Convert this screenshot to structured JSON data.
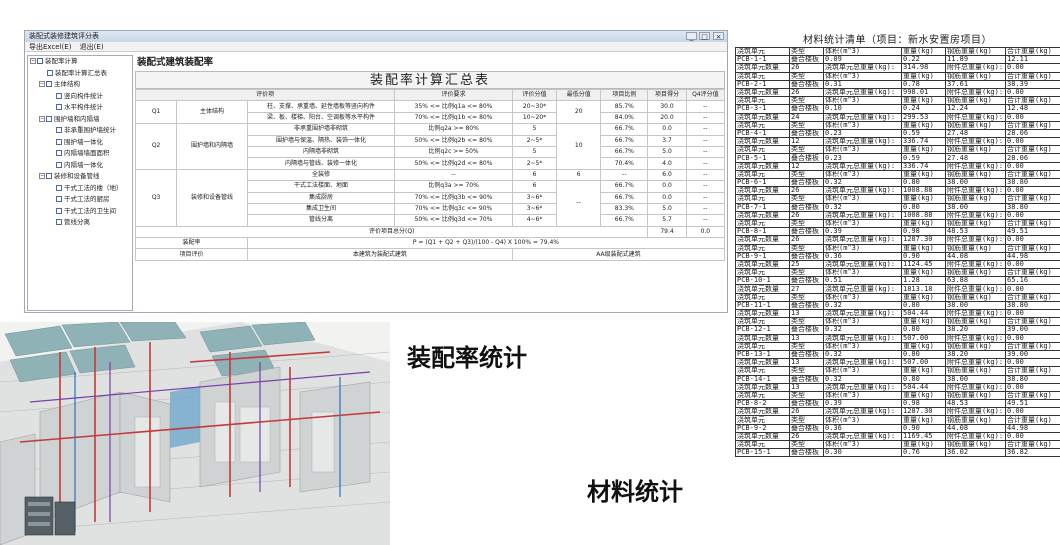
{
  "window": {
    "title": "装配式装修建筑评分表",
    "menu": [
      "导出Excel(E)",
      "退出(E)"
    ],
    "buttons": [
      "_",
      "□",
      "×"
    ]
  },
  "tree": [
    {
      "label": "装配率计算",
      "level": 0,
      "expander": "−"
    },
    {
      "label": "装配率计算汇总表",
      "level": 1
    },
    {
      "label": "主体结构",
      "level": 1,
      "expander": "−"
    },
    {
      "label": "竖向构件统计",
      "level": 2
    },
    {
      "label": "水平构件统计",
      "level": 2
    },
    {
      "label": "围护墙和内隔墙",
      "level": 1,
      "expander": "−"
    },
    {
      "label": "非承重围护墙统计",
      "level": 2
    },
    {
      "label": "围护墙一体化",
      "level": 2
    },
    {
      "label": "内隔墙墙面面积",
      "level": 2
    },
    {
      "label": "内隔墙一体化",
      "level": 2
    },
    {
      "label": "装修和设备管线",
      "level": 1,
      "expander": "−"
    },
    {
      "label": "干式工法的楼（地）",
      "level": 2
    },
    {
      "label": "干式工法的厨房",
      "level": 2
    },
    {
      "label": "干式工法的卫生间",
      "level": 2
    },
    {
      "label": "管线分离",
      "level": 2
    }
  ],
  "main": {
    "title": "装配式建筑装配率",
    "table_title": "装配率计算汇总表",
    "headers": [
      "评价项",
      "评价要求",
      "评价分值",
      "最低分值",
      "项目比例",
      "项目得分",
      "Q4评分值"
    ],
    "q1": {
      "code": "Q1",
      "name": "主体结构",
      "min": "20",
      "rows": [
        [
          "柱、支撑、承重墙、延性墙板等竖向构件",
          "35% <= 比例q1a <= 80%",
          "20~30*",
          "85.7%",
          "30.0",
          "--"
        ],
        [
          "梁、板、楼梯、阳台、空调板等水平构件",
          "70% <= 比例q1b <= 80%",
          "10~20*",
          "84.0%",
          "20.0",
          "--"
        ]
      ]
    },
    "q2": {
      "code": "Q2",
      "name": "围护墙和内隔墙",
      "min": "10",
      "rows": [
        [
          "非承重围护墙非砌筑",
          "比例q2a >= 80%",
          "5",
          "66.7%",
          "0.0",
          "--"
        ],
        [
          "围护墙与保温、隔热、装饰一体化",
          "50% <= 比例q2b <= 80%",
          "2~5*",
          "66.7%",
          "3.7",
          "--"
        ],
        [
          "内隔墙非砌筑",
          "比例q2c >= 50%",
          "5",
          "66.7%",
          "5.0",
          "--"
        ],
        [
          "内隔墙与管线、装修一体化",
          "50% <= 比例q2d <= 80%",
          "2~5*",
          "70.4%",
          "4.0",
          "--"
        ]
      ]
    },
    "q3": {
      "code": "Q3",
      "name": "装修和设备管线",
      "rows": [
        [
          "全装修",
          "--",
          "6",
          "6",
          "--",
          "6.0",
          "--"
        ],
        [
          "干式工法楼面、地面",
          "比例q3a >= 70%",
          "6",
          "",
          "66.7%",
          "0.0",
          "--"
        ],
        [
          "集成厨房",
          "70% <= 比例q3b <= 90%",
          "3~6*",
          "--",
          "66.7%",
          "0.0",
          "--"
        ],
        [
          "集成卫生间",
          "70% <= 比例q3c <= 90%",
          "3~6*",
          "",
          "83.3%",
          "5.0",
          "--"
        ],
        [
          "管线分离",
          "50% <= 比例q3d <= 70%",
          "4~6*",
          "",
          "66.7%",
          "5.7",
          "--"
        ]
      ]
    },
    "total": {
      "label": "评价项目总分(Q)",
      "score": "79.4",
      "q4": "0.0"
    },
    "rate": {
      "label": "装配率",
      "formula": "P = (Q1 + Q2 + Q3)/(100 - Q4) X 100% = 79.4%"
    },
    "evaluation": {
      "label": "项目评价",
      "value1": "本建筑为装配式建筑",
      "value2": "AA级装配式建筑"
    }
  },
  "captions": {
    "assembly": "装配率统计",
    "material": "材料统计"
  },
  "material": {
    "title": "材料统计清单（项目：新水安置房项目）",
    "rows": [
      [
        "浇筑单元",
        "类型",
        "体积(m^3)",
        "重量(kg)",
        "钢筋重量(kg)",
        "合计重量(kg)"
      ],
      [
        "PCB-1-1",
        "叠合楼板",
        "0.09",
        "0.22",
        "11.89",
        "12.11"
      ],
      [
        "浇筑单元数量",
        "26",
        "浇筑单元总重量(kg):",
        "314.98",
        "附件总重量(kg):",
        "0.00"
      ],
      [
        "浇筑单元",
        "类型",
        "体积(m^3)",
        "重量(kg)",
        "钢筋重量(kg)",
        "合计重量(kg)"
      ],
      [
        "PCB-2-1",
        "叠合楼板",
        "0.31",
        "0.78",
        "37.61",
        "38.39"
      ],
      [
        "浇筑单元数量",
        "26",
        "浇筑单元总重量(kg):",
        "998.01",
        "附件总重量(kg):",
        "0.00"
      ],
      [
        "浇筑单元",
        "类型",
        "体积(m^3)",
        "重量(kg)",
        "钢筋重量(kg)",
        "合计重量(kg)"
      ],
      [
        "PCB-3-1",
        "叠合楼板",
        "0.10",
        "0.24",
        "12.24",
        "12.48"
      ],
      [
        "浇筑单元数量",
        "24",
        "浇筑单元总重量(kg):",
        "299.53",
        "附件总重量(kg):",
        "0.00"
      ],
      [
        "浇筑单元",
        "类型",
        "体积(m^3)",
        "重量(kg)",
        "钢筋重量(kg)",
        "合计重量(kg)"
      ],
      [
        "PCB-4-1",
        "叠合楼板",
        "0.23",
        "0.59",
        "27.48",
        "28.06"
      ],
      [
        "浇筑单元数量",
        "12",
        "浇筑单元总重量(kg):",
        "336.74",
        "附件总重量(kg):",
        "0.00"
      ],
      [
        "浇筑单元",
        "类型",
        "体积(m^3)",
        "重量(kg)",
        "钢筋重量(kg)",
        "合计重量(kg)"
      ],
      [
        "PCB-5-1",
        "叠合楼板",
        "0.23",
        "0.59",
        "27.48",
        "28.06"
      ],
      [
        "浇筑单元数量",
        "12",
        "浇筑单元总重量(kg):",
        "336.74",
        "附件总重量(kg):",
        "0.00"
      ],
      [
        "浇筑单元",
        "类型",
        "体积(m^3)",
        "重量(kg)",
        "钢筋重量(kg)",
        "合计重量(kg)"
      ],
      [
        "PCB-6-1",
        "叠合楼板",
        "0.32",
        "0.80",
        "38.00",
        "38.80"
      ],
      [
        "浇筑单元数量",
        "26",
        "浇筑单元总重量(kg):",
        "1008.88",
        "附件总重量(kg):",
        "0.00"
      ],
      [
        "浇筑单元",
        "类型",
        "体积(m^3)",
        "重量(kg)",
        "钢筋重量(kg)",
        "合计重量(kg)"
      ],
      [
        "PCB-7-1",
        "叠合楼板",
        "0.32",
        "0.80",
        "38.00",
        "38.80"
      ],
      [
        "浇筑单元数量",
        "26",
        "浇筑单元总重量(kg):",
        "1008.88",
        "附件总重量(kg):",
        "0.00"
      ],
      [
        "浇筑单元",
        "类型",
        "体积(m^3)",
        "重量(kg)",
        "钢筋重量(kg)",
        "合计重量(kg)"
      ],
      [
        "PCB-8-1",
        "叠合楼板",
        "0.39",
        "0.98",
        "48.53",
        "49.51"
      ],
      [
        "浇筑单元数量",
        "26",
        "浇筑单元总重量(kg):",
        "1287.30",
        "附件总重量(kg):",
        "0.00"
      ],
      [
        "浇筑单元",
        "类型",
        "体积(m^3)",
        "重量(kg)",
        "钢筋重量(kg)",
        "合计重量(kg)"
      ],
      [
        "PCB-9-1",
        "叠合楼板",
        "0.36",
        "0.90",
        "44.08",
        "44.98"
      ],
      [
        "浇筑单元数量",
        "25",
        "浇筑单元总重量(kg):",
        "1124.45",
        "附件总重量(kg):",
        "0.00"
      ],
      [
        "浇筑单元",
        "类型",
        "体积(m^3)",
        "重量(kg)",
        "钢筋重量(kg)",
        "合计重量(kg)"
      ],
      [
        "PCB-10-1",
        "叠合楼板",
        "0.51",
        "1.28",
        "63.88",
        "65.16"
      ],
      [
        "浇筑单元数量",
        "27",
        "浇筑单元总重量(kg):",
        "1813.18",
        "附件总重量(kg):",
        "0.00"
      ],
      [
        "浇筑单元",
        "类型",
        "体积(m^3)",
        "重量(kg)",
        "钢筋重量(kg)",
        "合计重量(kg)"
      ],
      [
        "PCB-11-1",
        "叠合楼板",
        "0.32",
        "0.80",
        "38.00",
        "38.80"
      ],
      [
        "浇筑单元数量",
        "13",
        "浇筑单元总重量(kg):",
        "504.44",
        "附件总重量(kg):",
        "0.00"
      ],
      [
        "浇筑单元",
        "类型",
        "体积(m^3)",
        "重量(kg)",
        "钢筋重量(kg)",
        "合计重量(kg)"
      ],
      [
        "PCB-12-1",
        "叠合楼板",
        "0.32",
        "0.80",
        "38.20",
        "39.00"
      ],
      [
        "浇筑单元数量",
        "13",
        "浇筑单元总重量(kg):",
        "507.00",
        "附件总重量(kg):",
        "0.00"
      ],
      [
        "浇筑单元",
        "类型",
        "体积(m^3)",
        "重量(kg)",
        "钢筋重量(kg)",
        "合计重量(kg)"
      ],
      [
        "PCB-13-1",
        "叠合楼板",
        "0.32",
        "0.80",
        "38.20",
        "39.00"
      ],
      [
        "浇筑单元数量",
        "13",
        "浇筑单元总重量(kg):",
        "507.00",
        "附件总重量(kg):",
        "0.00"
      ],
      [
        "浇筑单元",
        "类型",
        "体积(m^3)",
        "重量(kg)",
        "钢筋重量(kg)",
        "合计重量(kg)"
      ],
      [
        "PCB-14-1",
        "叠合楼板",
        "0.32",
        "0.80",
        "38.00",
        "38.80"
      ],
      [
        "浇筑单元数量",
        "13",
        "浇筑单元总重量(kg):",
        "504.44",
        "附件总重量(kg):",
        "0.00"
      ],
      [
        "浇筑单元",
        "类型",
        "体积(m^3)",
        "重量(kg)",
        "钢筋重量(kg)",
        "合计重量(kg)"
      ],
      [
        "PCB-8-2",
        "叠合楼板",
        "0.39",
        "0.98",
        "48.53",
        "49.51"
      ],
      [
        "浇筑单元数量",
        "26",
        "浇筑单元总重量(kg):",
        "1287.30",
        "附件总重量(kg):",
        "0.00"
      ],
      [
        "浇筑单元",
        "类型",
        "体积(m^3)",
        "重量(kg)",
        "钢筋重量(kg)",
        "合计重量(kg)"
      ],
      [
        "PCB-9-2",
        "叠合楼板",
        "0.36",
        "0.90",
        "44.08",
        "44.98"
      ],
      [
        "浇筑单元数量",
        "26",
        "浇筑单元总重量(kg):",
        "1169.45",
        "附件总重量(kg):",
        "0.00"
      ],
      [
        "浇筑单元",
        "类型",
        "体积(m^3)",
        "重量(kg)",
        "钢筋重量(kg)",
        "合计重量(kg)"
      ],
      [
        "PCB-15-1",
        "叠合楼板",
        "0.30",
        "0.76",
        "36.02",
        "36.82"
      ]
    ]
  }
}
